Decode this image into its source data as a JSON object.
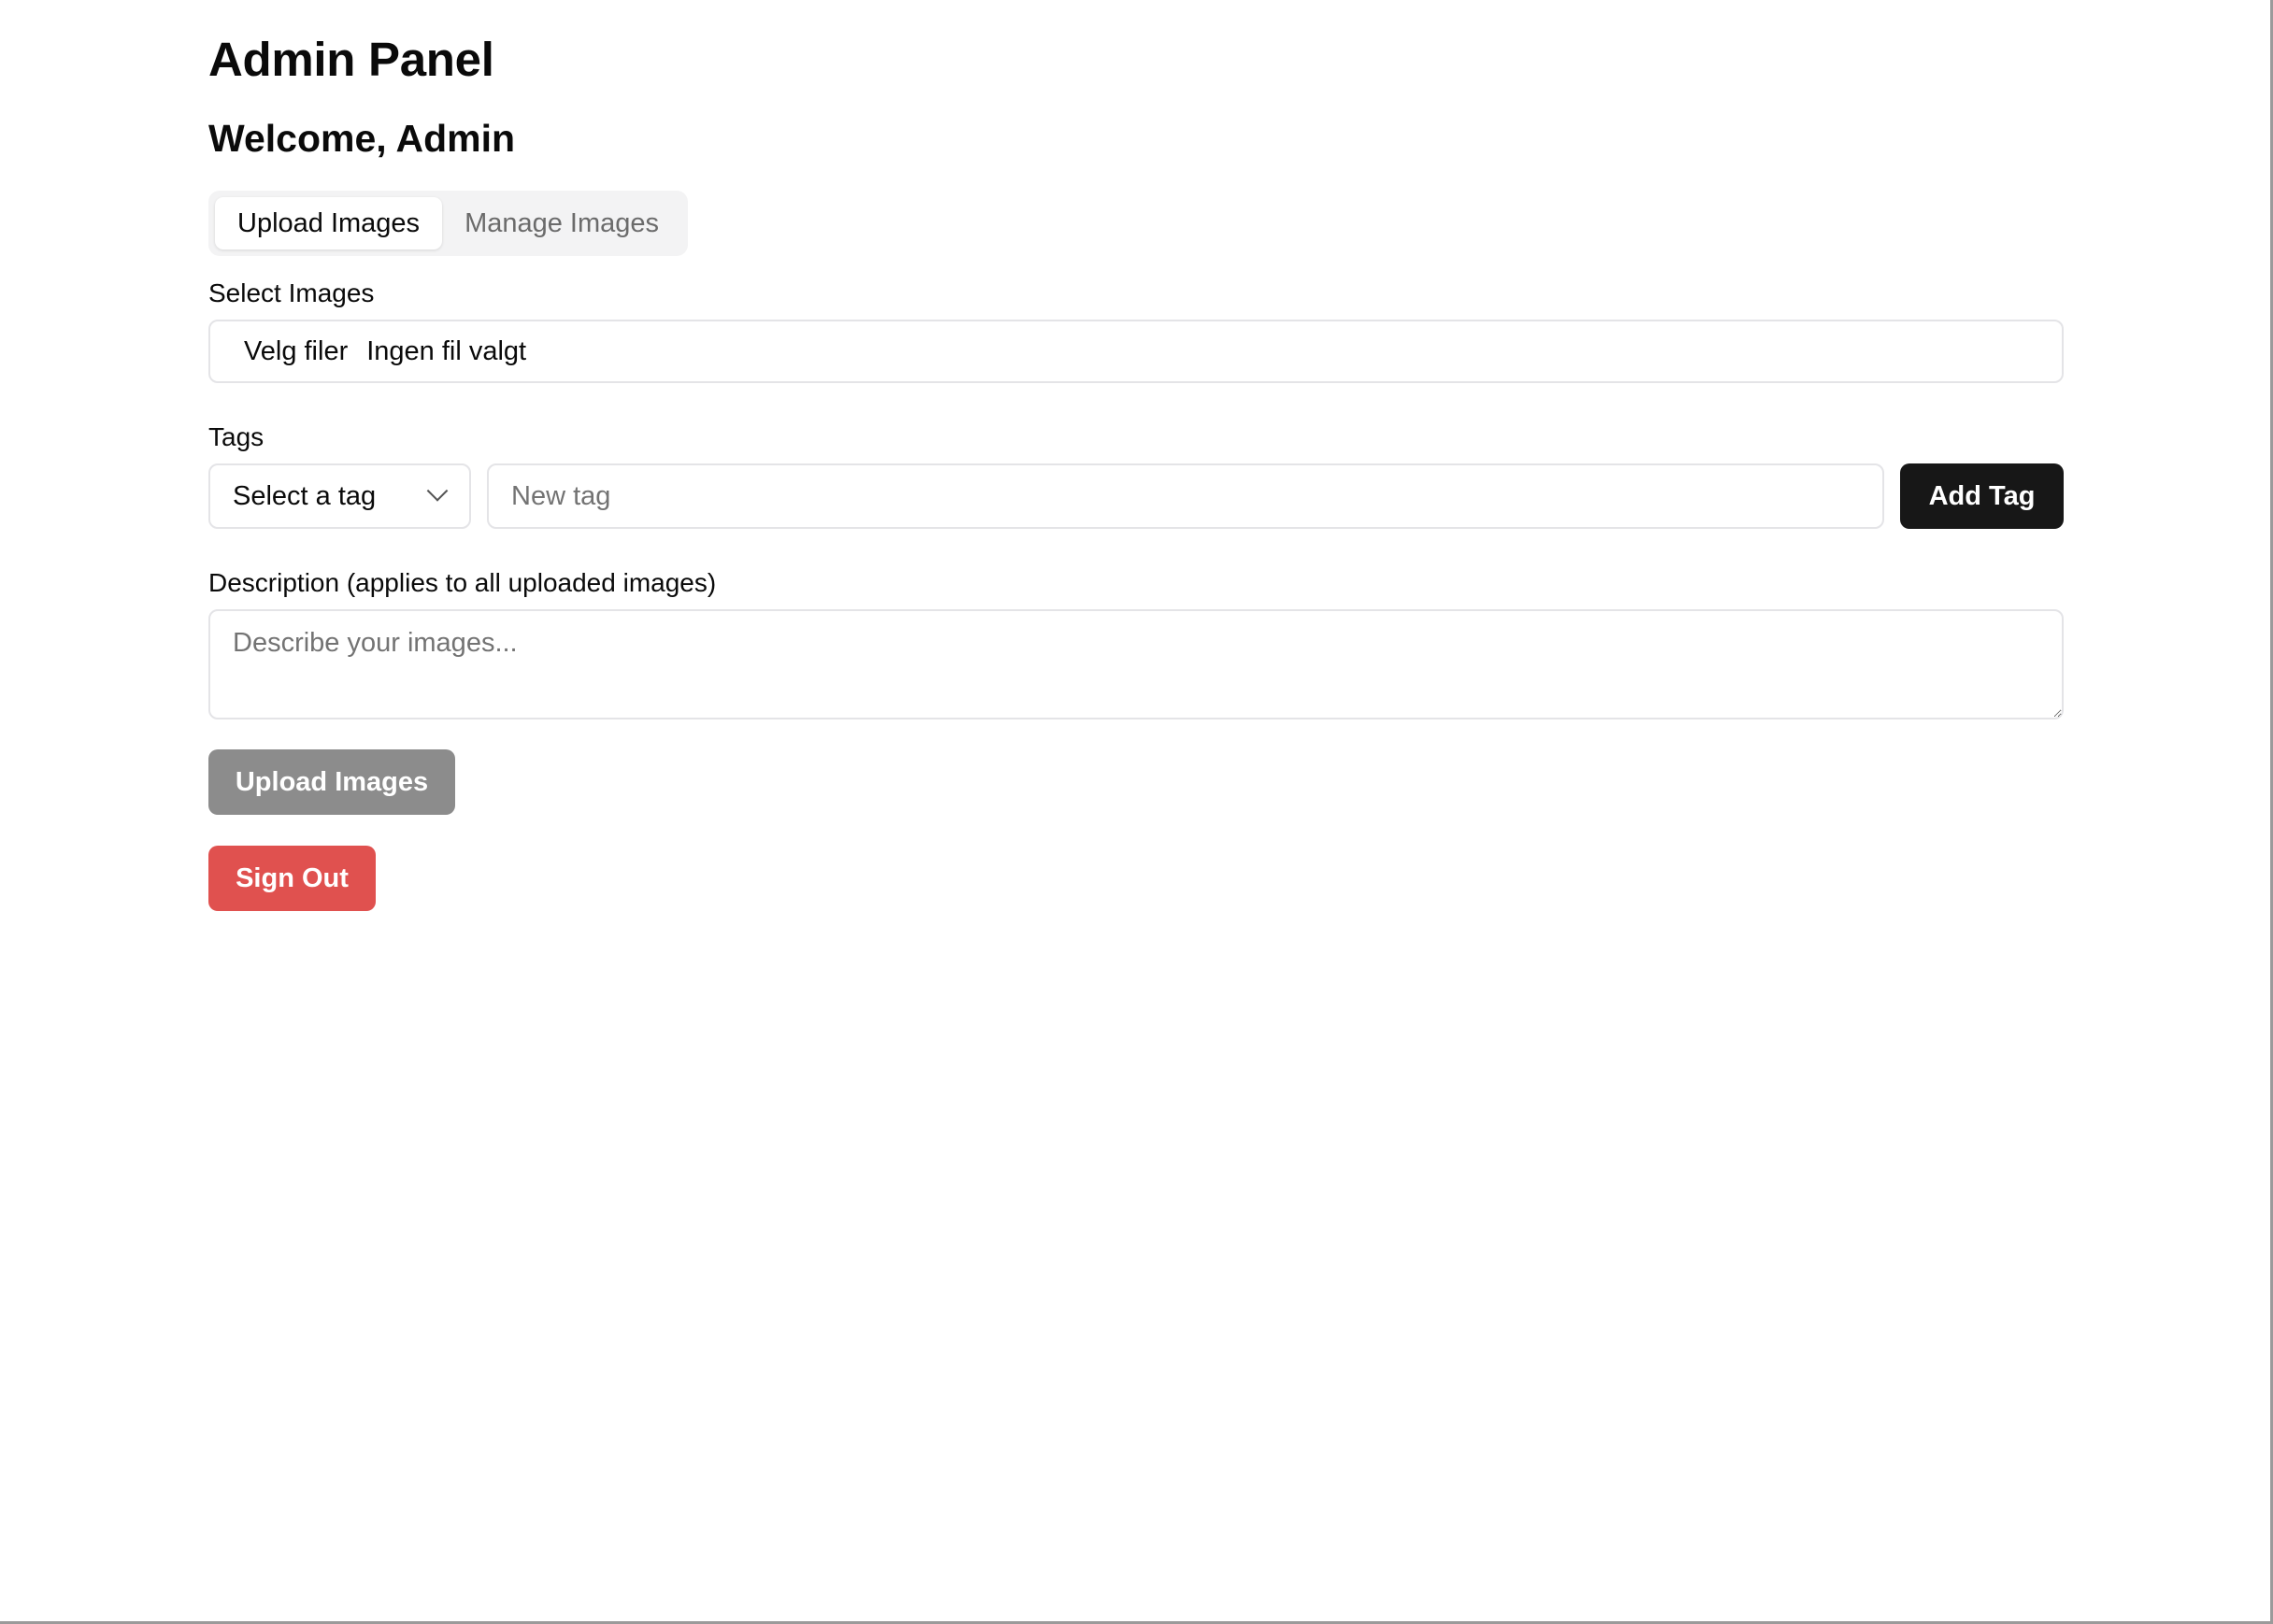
{
  "header": {
    "title": "Admin Panel",
    "welcome": "Welcome, Admin"
  },
  "tabs": [
    {
      "label": "Upload Images",
      "active": true
    },
    {
      "label": "Manage Images",
      "active": false
    }
  ],
  "files": {
    "label": "Select Images",
    "button_label": "Velg filer",
    "status": "Ingen fil valgt"
  },
  "tags": {
    "label": "Tags",
    "select_value": "Select a tag",
    "new_tag_placeholder": "New tag",
    "add_button": "Add Tag"
  },
  "description": {
    "label": "Description (applies to all uploaded images)",
    "placeholder": "Describe your images..."
  },
  "actions": {
    "upload_label": "Upload Images",
    "signout_label": "Sign Out"
  },
  "colors": {
    "primary_dark": "#171717",
    "upload_disabled": "#8c8c8c",
    "signout_red": "#e0514f",
    "border": "#e4e4e7",
    "tabs_bg": "#f3f3f4"
  }
}
